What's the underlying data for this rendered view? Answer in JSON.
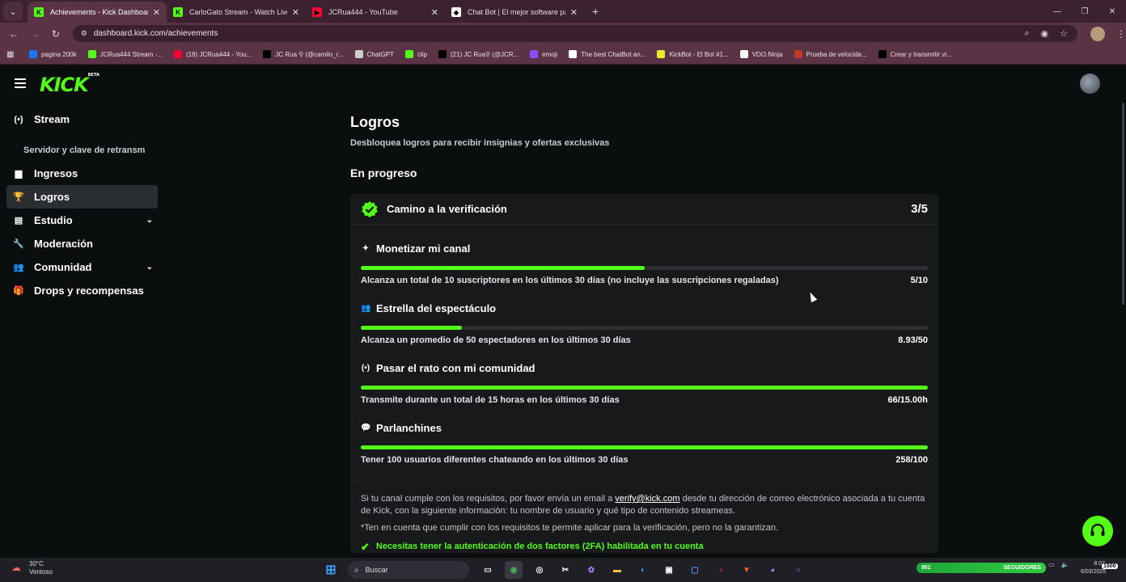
{
  "browser": {
    "tabs": [
      {
        "title": "Achievements - Kick Dashboard",
        "icon": "kick-icon",
        "color": "#53fc18",
        "active": true
      },
      {
        "title": "CarloGato Stream - Watch Live",
        "icon": "kick-icon",
        "color": "#53fc18",
        "active": false
      },
      {
        "title": "JCRua444 - YouTube",
        "icon": "youtube-icon",
        "color": "#ff0033",
        "active": false
      },
      {
        "title": "Chat Bot | El mejor software pa",
        "icon": "chatbot-icon",
        "color": "#ffffff",
        "active": false
      }
    ],
    "url": "dashboard.kick.com/achievements",
    "bookmarks": [
      {
        "label": "pagina 200k",
        "icon": "facebook-icon",
        "color": "#1877f2"
      },
      {
        "label": "JCRua444 Stream -...",
        "icon": "kick-icon",
        "color": "#53fc18"
      },
      {
        "label": "(18) JCRua444 - You...",
        "icon": "youtube-icon",
        "color": "#ff0033"
      },
      {
        "label": "JC Rua ⚲ (@camilo_r...",
        "icon": "tiktok-icon",
        "color": "#000000"
      },
      {
        "label": "ChatGPT",
        "icon": "chatgpt-icon",
        "color": "#cccccc"
      },
      {
        "label": "clip",
        "icon": "clip-icon",
        "color": "#53fc18"
      },
      {
        "label": "(21) JC Rua⚲ (@JCR...",
        "icon": "x-icon",
        "color": "#000000"
      },
      {
        "label": "emoji",
        "icon": "emoji-icon",
        "color": "#9146ff"
      },
      {
        "label": "The best ChatBot an...",
        "icon": "chatbot-icon",
        "color": "#ffffff"
      },
      {
        "label": "KickBot - El Bot #1...",
        "icon": "kickbot-icon",
        "color": "#e8e832"
      },
      {
        "label": "VDO.Ninja",
        "icon": "vdo-ninja-icon",
        "color": "#ffffff"
      },
      {
        "label": "Prueba de velocida...",
        "icon": "speedtest-icon",
        "color": "#c0392b"
      },
      {
        "label": "Crear y transmitir vi...",
        "icon": "r-icon",
        "color": "#000000"
      }
    ]
  },
  "kick": {
    "logo": "KICK",
    "logo_tag": "BETA",
    "sidebar": [
      {
        "label": "Stream",
        "icon": "broadcast-icon",
        "glyph": "(•)",
        "active": false,
        "chevron": false,
        "sub": false
      },
      {
        "label": "Servidor y clave de retransm",
        "icon": "",
        "glyph": "",
        "active": false,
        "chevron": false,
        "sub": true
      },
      {
        "label": "Ingresos",
        "icon": "bar-chart-icon",
        "glyph": "▆",
        "active": false,
        "chevron": false,
        "sub": false
      },
      {
        "label": "Logros",
        "icon": "trophy-icon",
        "glyph": "🏆",
        "active": true,
        "chevron": false,
        "sub": false
      },
      {
        "label": "Estudio",
        "icon": "studio-icon",
        "glyph": "▤",
        "active": false,
        "chevron": true,
        "sub": false
      },
      {
        "label": "Moderación",
        "icon": "wrench-icon",
        "glyph": "🔧",
        "active": false,
        "chevron": false,
        "sub": false
      },
      {
        "label": "Comunidad",
        "icon": "community-icon",
        "glyph": "👥",
        "active": false,
        "chevron": true,
        "sub": false
      },
      {
        "label": "Drops y recompensas",
        "icon": "drops-icon",
        "glyph": "🎁",
        "active": false,
        "chevron": false,
        "sub": false
      }
    ],
    "page_title": "Logros",
    "page_subtitle": "Desbloquea logros para recibir insignias y ofertas exclusivas",
    "section_title": "En progreso",
    "card": {
      "title": "Camino a la verificación",
      "count": "3/5",
      "achievements": [
        {
          "title": "Monetizar mi canal",
          "icon": "sparkle-icon",
          "glyph": "✦",
          "progress": 0.5,
          "desc": "Alcanza un total de 10 suscriptores en los últimos 30 días (no incluye las suscripciones regaladas)",
          "value": "5/10"
        },
        {
          "title": "Estrella del espectáculo",
          "icon": "viewers-icon",
          "glyph": "👥",
          "progress": 0.1786,
          "desc": "Alcanza un promedio de 50 espectadores en los últimos 30 días",
          "value": "8.93/50"
        },
        {
          "title": "Pasar el rato con mi comunidad",
          "icon": "broadcast-icon",
          "glyph": "(•)",
          "progress": 1.0,
          "desc": "Transmite durante un total de 15 horas en los últimos 30 días",
          "value": "66/15.00h"
        },
        {
          "title": "Parlanchines",
          "icon": "chat-bubble-icon",
          "glyph": "💬",
          "progress": 1.0,
          "desc": "Tener 100 usuarios diferentes chateando en los últimos 30 días",
          "value": "258/100"
        }
      ],
      "note_part1": "Si tu canal cumple con los requisitos, por favor envía un email a ",
      "note_email": "verify@kick.com",
      "note_part2": " desde tu dirección de correo electrónico asociada a tu cuenta de Kick, con la siguiente información: tu nombre de usuario y qué tipo de contenido streameas.",
      "note_disclaimer": "*Ten en cuenta que cumplir con los requisitos te permite aplicar para la verificación, pero no la garantizan.",
      "requirement": "Necesitas tener la autenticación de dos factores (2FA) habilitada en tu cuenta"
    },
    "accent": "#53fc18"
  },
  "taskbar": {
    "weather_temp": "30°C",
    "weather_desc": "Ventoso",
    "search_label": "Buscar",
    "followers_count": "951",
    "followers_label": "SEGUIDORES",
    "time": "8:07",
    "date": "6/03/2025",
    "notif": "1500"
  }
}
